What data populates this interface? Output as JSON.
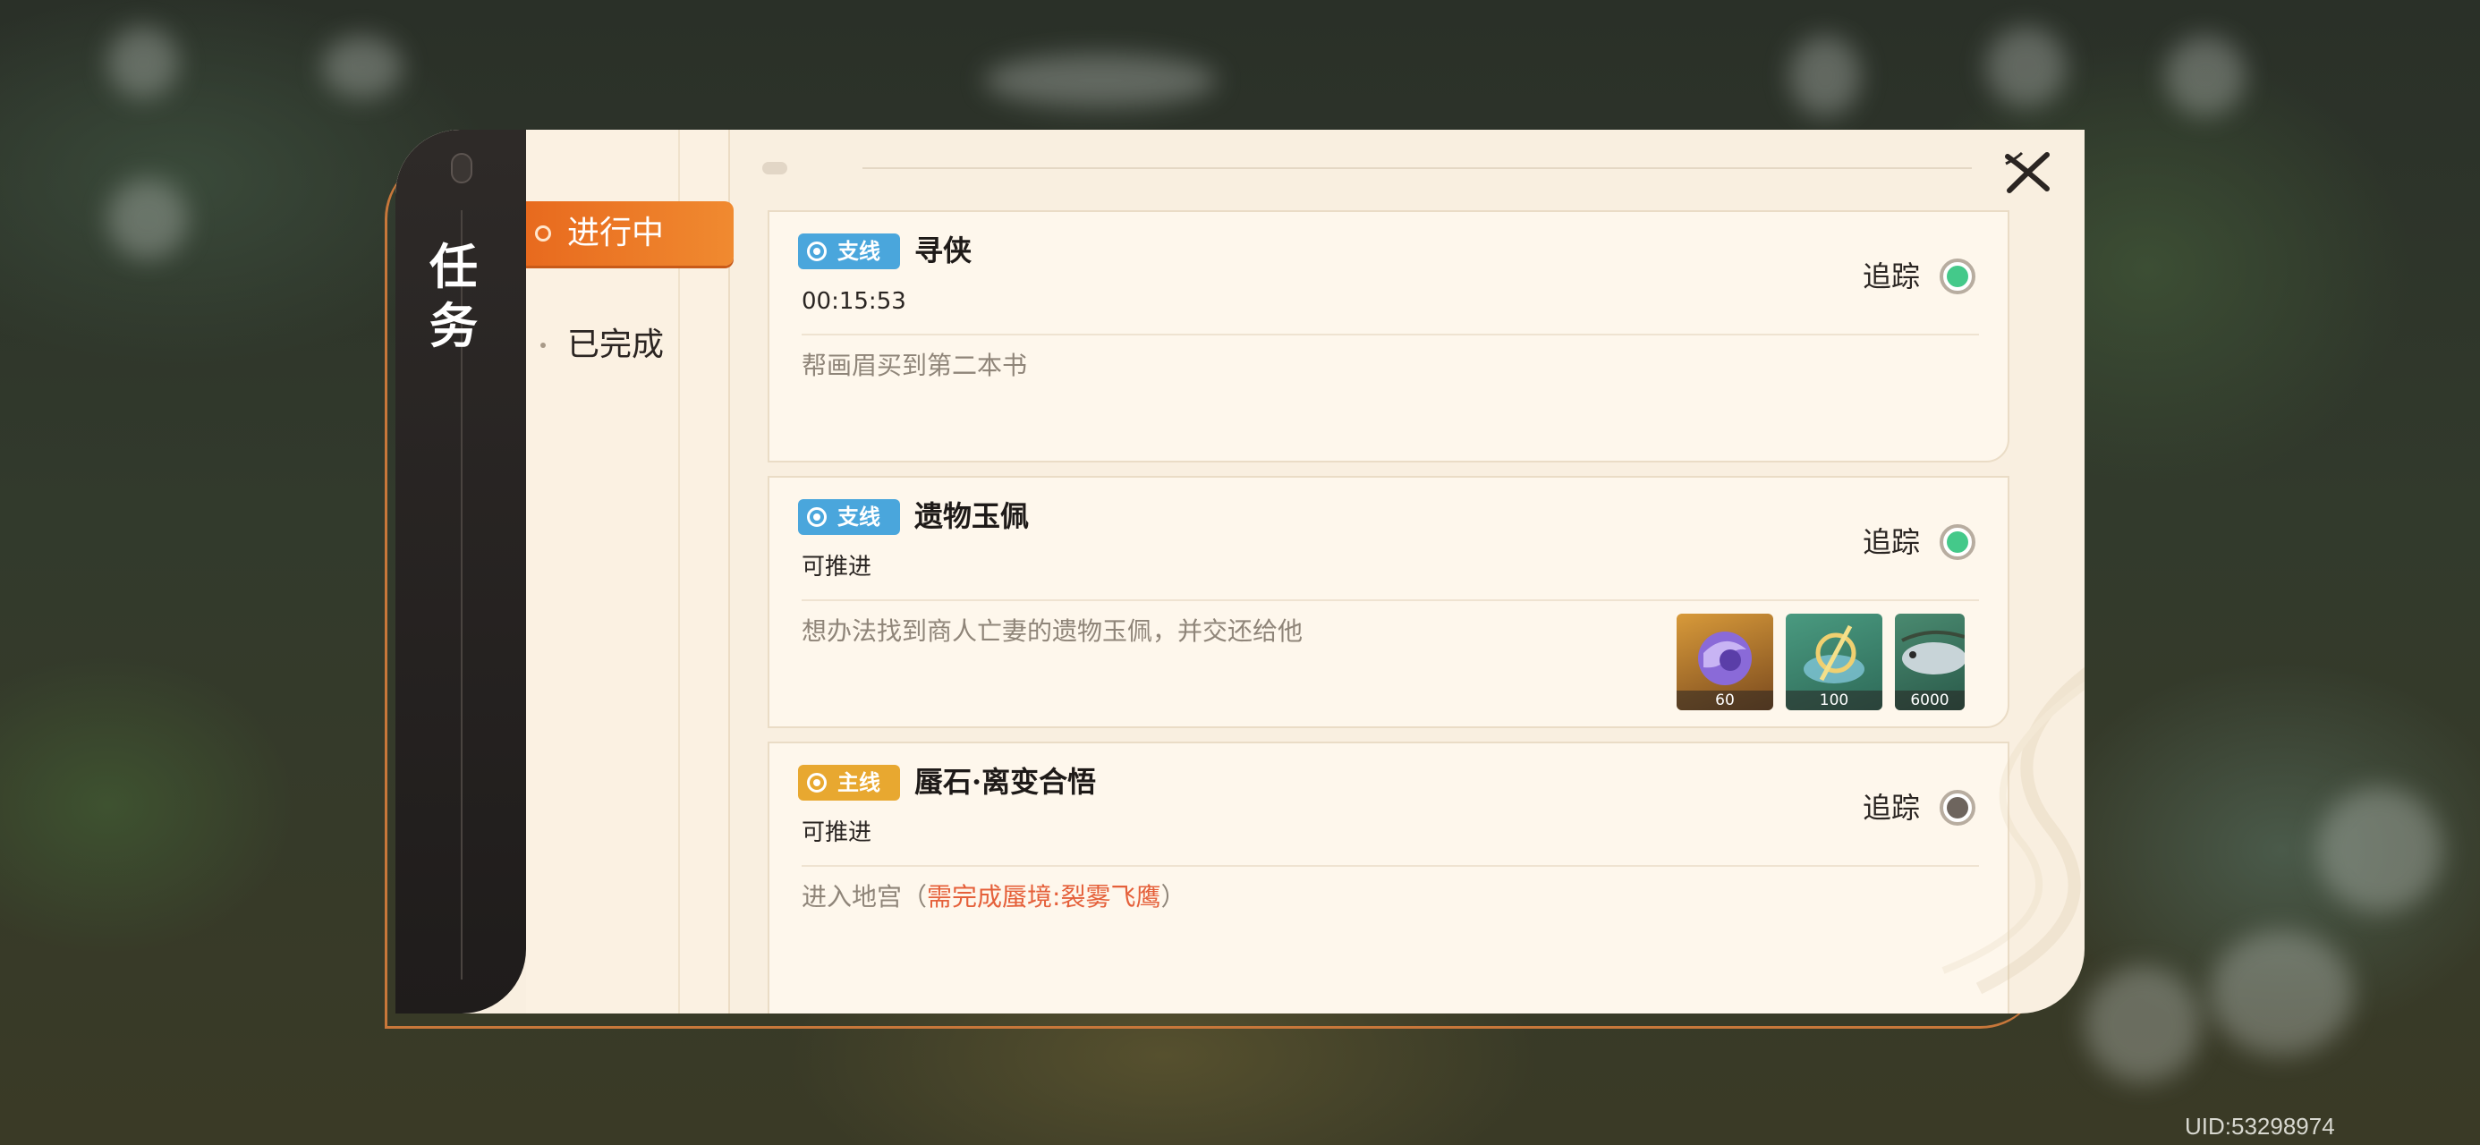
{
  "panel": {
    "title": "任务",
    "tabs": [
      {
        "label": "进行中",
        "active": true
      },
      {
        "label": "已完成",
        "active": false
      }
    ],
    "close_icon": "close-icon"
  },
  "quests": [
    {
      "type_label": "支线",
      "type_color": "#4aa6dc",
      "title": "寻侠",
      "status": "00:15:53",
      "description": "帮画眉买到第二本书",
      "track_label": "追踪",
      "tracked": true,
      "track_color": "#44c98a"
    },
    {
      "type_label": "支线",
      "type_color": "#4aa6dc",
      "title": "遗物玉佩",
      "status": "可推进",
      "description": "想办法找到商人亡妻的遗物玉佩，并交还给他",
      "track_label": "追踪",
      "tracked": true,
      "track_color": "#44c98a",
      "rewards": [
        {
          "icon": "purple-whale-item-icon",
          "count": "60"
        },
        {
          "icon": "golden-compass-item-icon",
          "count": "100"
        },
        {
          "icon": "fish-item-icon",
          "count": "6000"
        }
      ]
    },
    {
      "type_label": "主线",
      "type_color": "#e8a830",
      "title": "蜃石·离变合悟",
      "status": "可推进",
      "description_prefix": "进入地宫（",
      "description_requirement": "需完成蜃境:裂雾飞鹰",
      "description_suffix": "）",
      "track_label": "追踪",
      "tracked": false,
      "track_color": "#6e655e"
    }
  ],
  "footer": {
    "uid": "UID:53298974"
  }
}
